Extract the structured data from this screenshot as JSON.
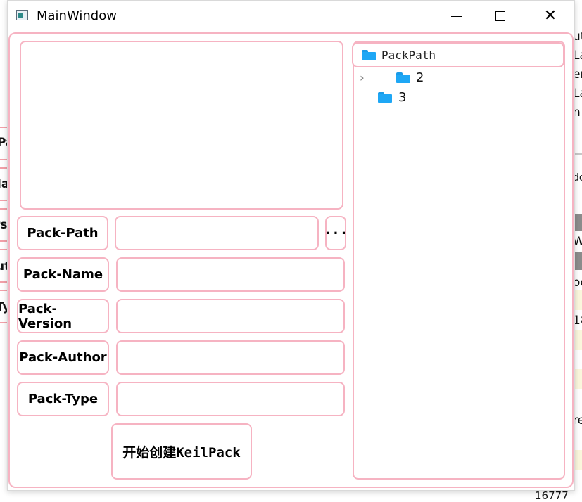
{
  "window": {
    "title": "MainWindow",
    "caption_buttons": [
      "minimize",
      "maximize",
      "close"
    ]
  },
  "form": {
    "fields": [
      {
        "label": "Pack-Path",
        "value": ""
      },
      {
        "label": "Pack-Name",
        "value": ""
      },
      {
        "label": "Pack-Version",
        "value": ""
      },
      {
        "label": "Pack-Author",
        "value": ""
      },
      {
        "label": "Pack-Type",
        "value": ""
      }
    ],
    "browse_label": "···",
    "create_button": "开始创建KeilPack"
  },
  "tree": {
    "root": "PackPath",
    "items": [
      {
        "label": "2",
        "expandable": true
      },
      {
        "label": "3",
        "expandable": false
      }
    ]
  },
  "background_window": {
    "right_fragments": [
      "ut",
      "La",
      "er",
      "La",
      "n",
      "dc",
      "Wi",
      "od",
      "18",
      "re",
      "16777"
    ],
    "left_fragments": [
      "Pa",
      "la",
      "rs",
      "ut",
      "Ty"
    ]
  },
  "colors": {
    "accent_border": "#f6b3c2",
    "folder_blue": "#1ea7f5"
  }
}
